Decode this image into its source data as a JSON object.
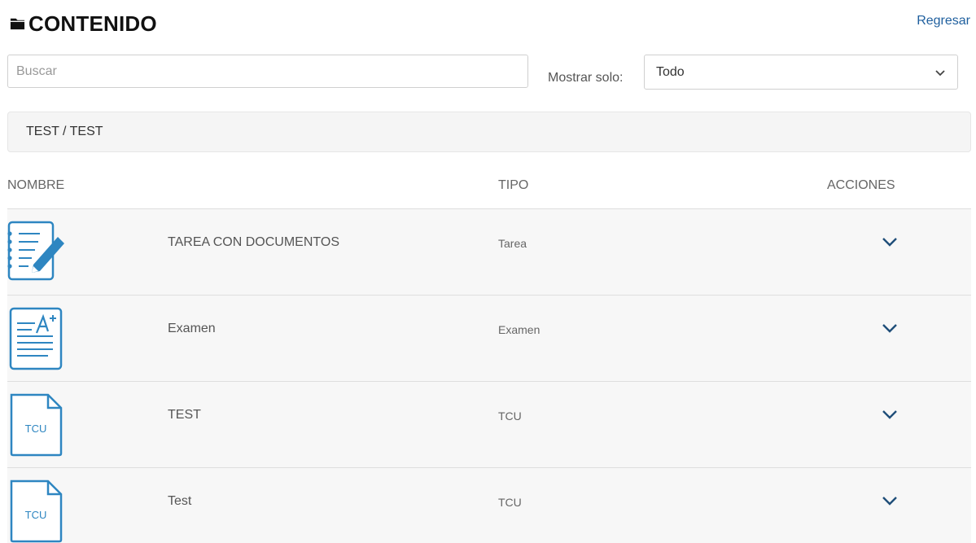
{
  "header": {
    "title": "CONTENIDO",
    "back_label": "Regresar",
    "title_icon": "folder-icon"
  },
  "search": {
    "placeholder": "Buscar",
    "value": ""
  },
  "filter": {
    "label": "Mostrar solo:",
    "value": "Todo",
    "icon": "chevron-down-icon"
  },
  "breadcrumb": "TEST / TEST",
  "table": {
    "columns": [
      "NOMBRE",
      "TIPO",
      "ACCIONES"
    ],
    "rows": [
      {
        "name": "TAREA CON DOCUMENTOS",
        "type": "Tarea",
        "icon": "assignment-icon"
      },
      {
        "name": "Examen",
        "type": "Examen",
        "icon": "exam-icon"
      },
      {
        "name": "TEST",
        "type": "TCU",
        "icon": "tcu-file-icon",
        "icon_label": "TCU"
      },
      {
        "name": "Test",
        "type": "TCU",
        "icon": "tcu-file-icon",
        "icon_label": "TCU"
      }
    ]
  },
  "colors": {
    "icon_blue": "#2e86c1",
    "link_blue": "#1f5f9e",
    "chevron": "#1f4e79",
    "row_bg": "#f7f7f7"
  }
}
